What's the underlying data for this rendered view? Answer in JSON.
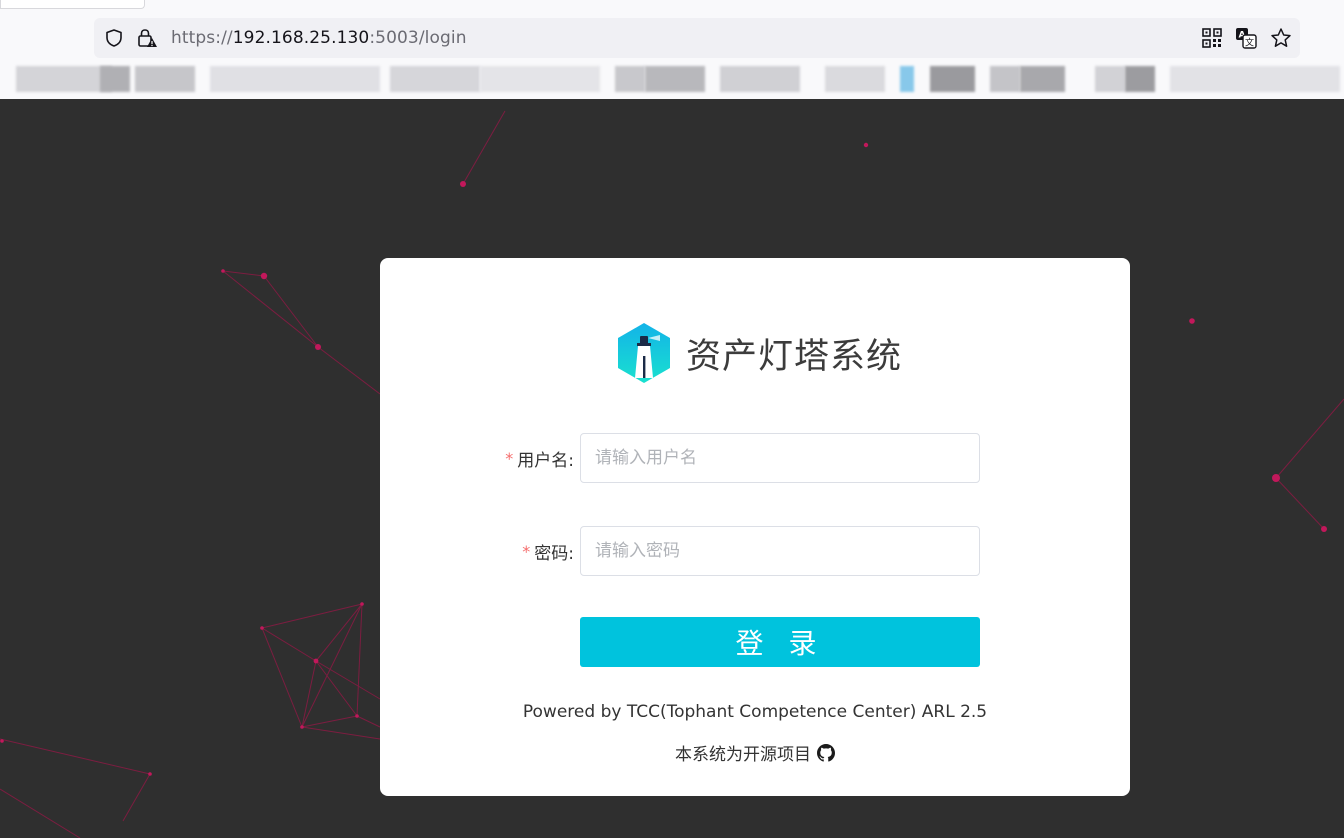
{
  "browser": {
    "url_prefix": "https://",
    "url_host": "192.168.25.130",
    "url_rest": ":5003/login",
    "icons": {
      "tracking": "shield-icon",
      "security": "lock-warning-icon",
      "qr": "qr-code-icon",
      "translate": "translate-icon",
      "bookmark": "star-icon"
    }
  },
  "login": {
    "brand_title": "资产灯塔系统",
    "logo": "lighthouse-logo-icon",
    "username": {
      "label": "用户名:",
      "required_mark": "*",
      "placeholder": "请输入用户名",
      "value": ""
    },
    "password": {
      "label": "密码:",
      "required_mark": "*",
      "placeholder": "请输入密码",
      "value": ""
    },
    "submit_label": "登 录",
    "powered_by": "Powered by TCC(Tophant Competence Center) ARL 2.5",
    "open_source_text": "本系统为开源项目",
    "open_source_icon": "github-icon"
  },
  "colors": {
    "accent": "#00c3dd",
    "background": "#2f2f2f",
    "particle": "#c2185b",
    "required": "#f56c6c"
  }
}
